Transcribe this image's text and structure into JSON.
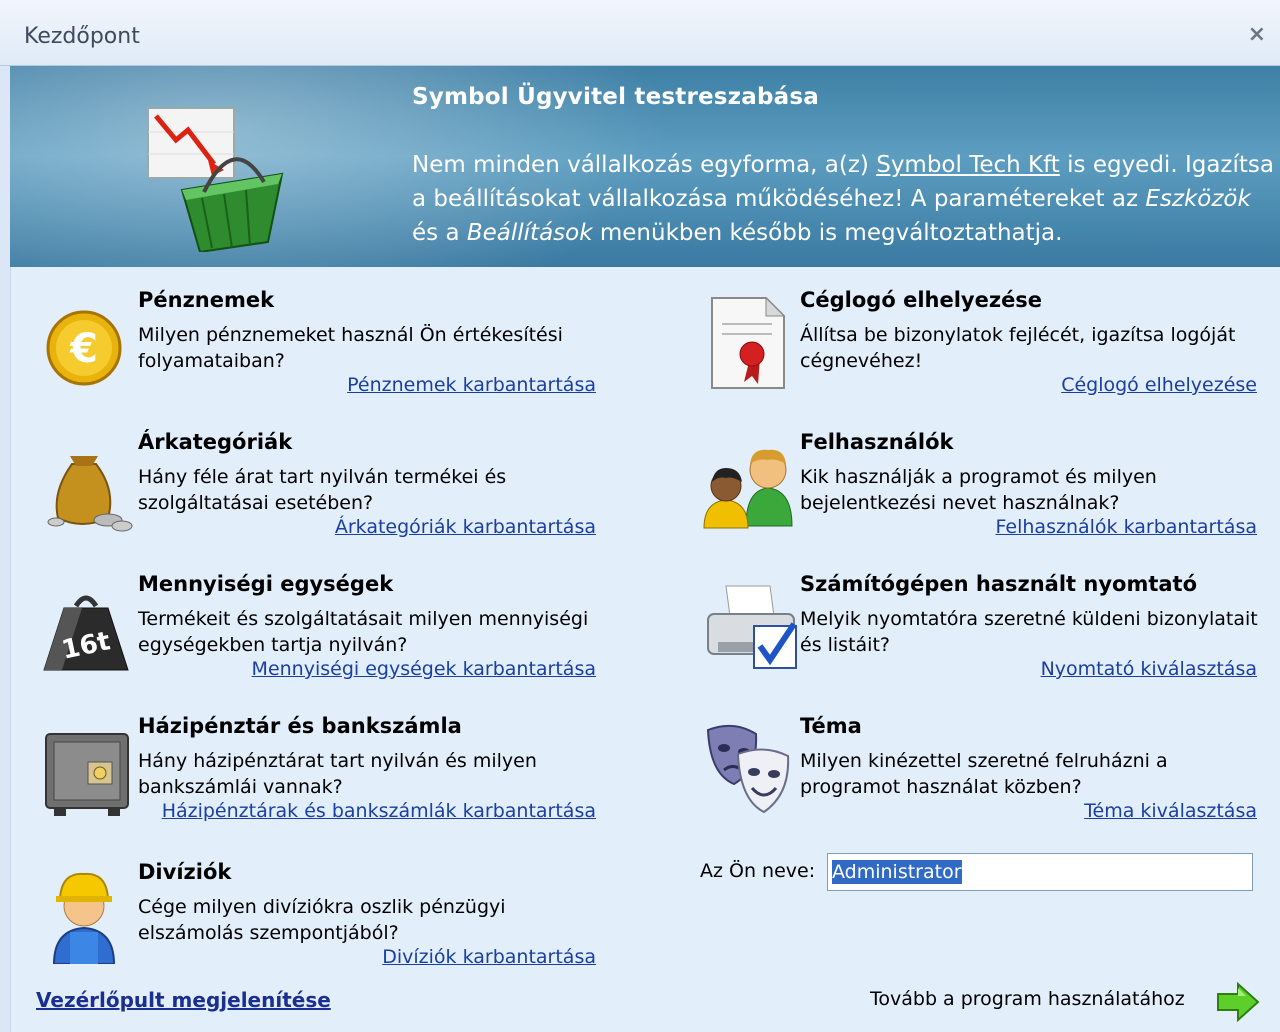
{
  "window": {
    "title": "Kezdőpont",
    "close_glyph": "×"
  },
  "banner": {
    "heading": "Symbol Ügyvitel testreszabása",
    "desc_part1": "Nem minden vállalkozás egyforma, a(z) ",
    "company_link": "Symbol Tech Kft",
    "desc_part2": " is egyedi. Igazítsa a beállításokat vállalkozása működéséhez! A paramétereket az ",
    "menu_tools": "Eszközök",
    "desc_part3": " és a ",
    "menu_settings": "Beállítások",
    "desc_part4": " menükben később is megváltoztathatja."
  },
  "sections": {
    "currencies": {
      "title": "Pénznemek",
      "desc": "Milyen pénznemeket használ Ön értékesítési folyamataiban?",
      "link": "Pénznemek karbantartása",
      "icon": "euro-coin-icon"
    },
    "price_categories": {
      "title": "Árkategóriák",
      "desc": "Hány féle árat tart nyilván termékei és szolgáltatásai esetében?",
      "link": "Árkategóriák karbantartása",
      "icon": "money-bag-icon"
    },
    "units": {
      "title": "Mennyiségi egységek",
      "desc": "Termékeit és szolgáltatásait milyen mennyiségi egységekben tartja nyilván?",
      "link": "Mennyiségi egységek karbantartása",
      "icon": "weight-16t-icon"
    },
    "cash_bank": {
      "title": "Házipénztár és bankszámla",
      "desc": "Hány házipénztárat tart nyilván és milyen bankszámlái vannak?",
      "link": "Házipénztárak és bankszámlák karbantartása",
      "icon": "safe-icon"
    },
    "divisions": {
      "title": "Divíziók",
      "desc": "Cége milyen divíziókra oszlik pénzügyi elszámolás szempontjából?",
      "link": "Divíziók karbantartása",
      "icon": "worker-icon"
    },
    "logo": {
      "title": "Céglogó elhelyezése",
      "desc": "Állítsa be bizonylatok fejlécét, igazítsa logóját cégnevéhez!",
      "link": "Céglogó elhelyezése",
      "icon": "certificate-icon"
    },
    "users": {
      "title": "Felhasználók",
      "desc": "Kik használják a programot és milyen bejelentkezési nevet használnak?",
      "link": "Felhasználók karbantartása",
      "icon": "users-icon"
    },
    "printer": {
      "title": "Számítógépen használt nyomtató",
      "desc": "Melyik nyomtatóra szeretné küldeni bizonylatait és listáit?",
      "link": "Nyomtató kiválasztása",
      "icon": "printer-check-icon"
    },
    "theme": {
      "title": "Téma",
      "desc": "Milyen kinézettel szeretné felruházni a programot használat közben?",
      "link": "Téma kiválasztása",
      "icon": "theater-masks-icon"
    }
  },
  "name_field": {
    "label": "Az Ön neve:",
    "value": "Administrator"
  },
  "footer": {
    "control_panel_link": "Vezérlőpult megjelenítése",
    "continue_label": "Tovább a program használatához"
  },
  "colors": {
    "link": "#1a3fa3",
    "background": "#e3eefb",
    "banner": "#4a8bb2",
    "selection": "#316ac5"
  }
}
